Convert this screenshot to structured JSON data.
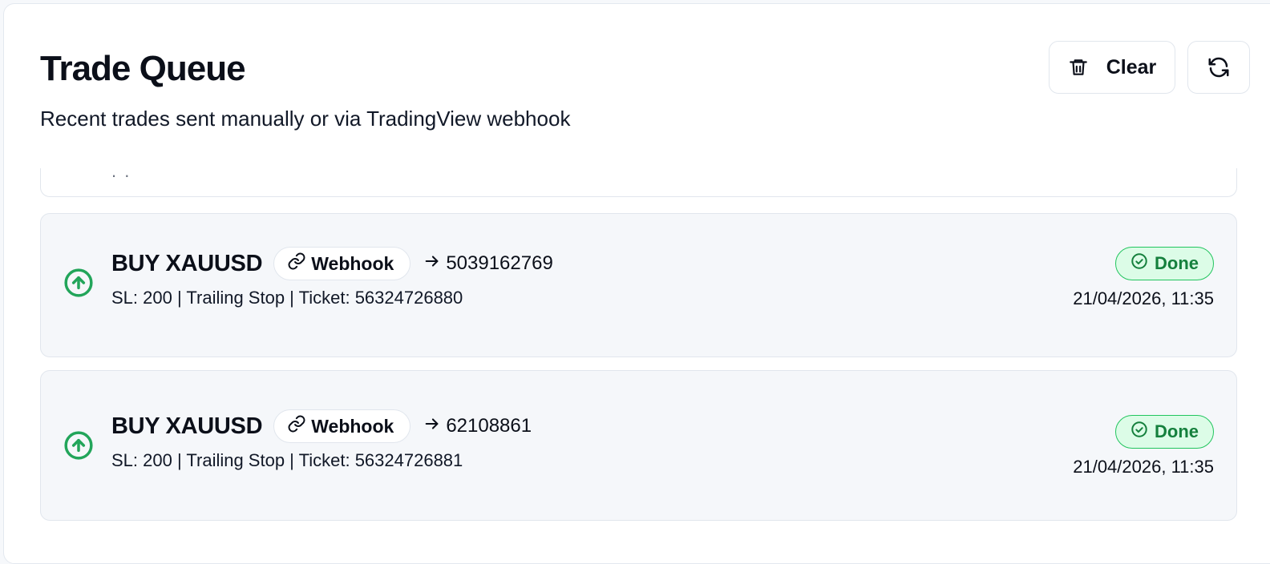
{
  "header": {
    "title": "Trade Queue",
    "subtitle": "Recent trades sent manually or via TradingView webhook",
    "clear_label": "Clear"
  },
  "partial_row": {
    "text": ". ."
  },
  "trades": [
    {
      "side_symbol": "BUY XAUUSD",
      "source": "Webhook",
      "target": "5039162769",
      "details": "SL: 200 | Trailing Stop | Ticket: 56324726880",
      "status": "Done",
      "timestamp": "21/04/2026, 11:35"
    },
    {
      "side_symbol": "BUY XAUUSD",
      "source": "Webhook",
      "target": "62108861",
      "details": "SL: 200 | Trailing Stop | Ticket: 56324726881",
      "status": "Done",
      "timestamp": "21/04/2026, 11:35"
    }
  ],
  "colors": {
    "buy_green": "#22a55a",
    "status_bg": "#dcfce7",
    "status_border": "#22c55e",
    "status_text": "#15803d"
  },
  "icons": {
    "clear": "trash-icon",
    "refresh": "refresh-icon",
    "buy": "arrow-up-circle-icon",
    "source": "link-icon",
    "status": "check-circle-icon"
  }
}
